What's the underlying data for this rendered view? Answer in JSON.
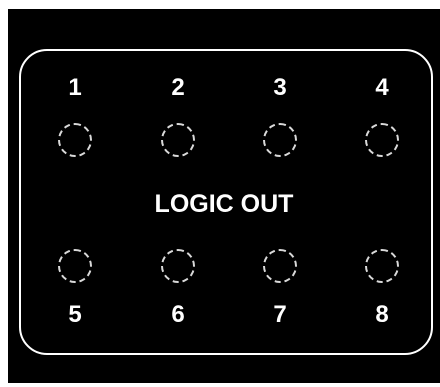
{
  "module": {
    "title": "LOGIC OUT",
    "outputs": [
      {
        "number": "1",
        "label": "output-1"
      },
      {
        "number": "2",
        "label": "output-2"
      },
      {
        "number": "3",
        "label": "output-3"
      },
      {
        "number": "4",
        "label": "output-4"
      },
      {
        "number": "5",
        "label": "output-5"
      },
      {
        "number": "6",
        "label": "output-6"
      },
      {
        "number": "7",
        "label": "output-7"
      },
      {
        "number": "8",
        "label": "output-8"
      }
    ],
    "colors": {
      "background": "#000000",
      "text": "#ffffff",
      "frame": "#ffffff",
      "jack_outline": "#d9d9d9"
    }
  }
}
